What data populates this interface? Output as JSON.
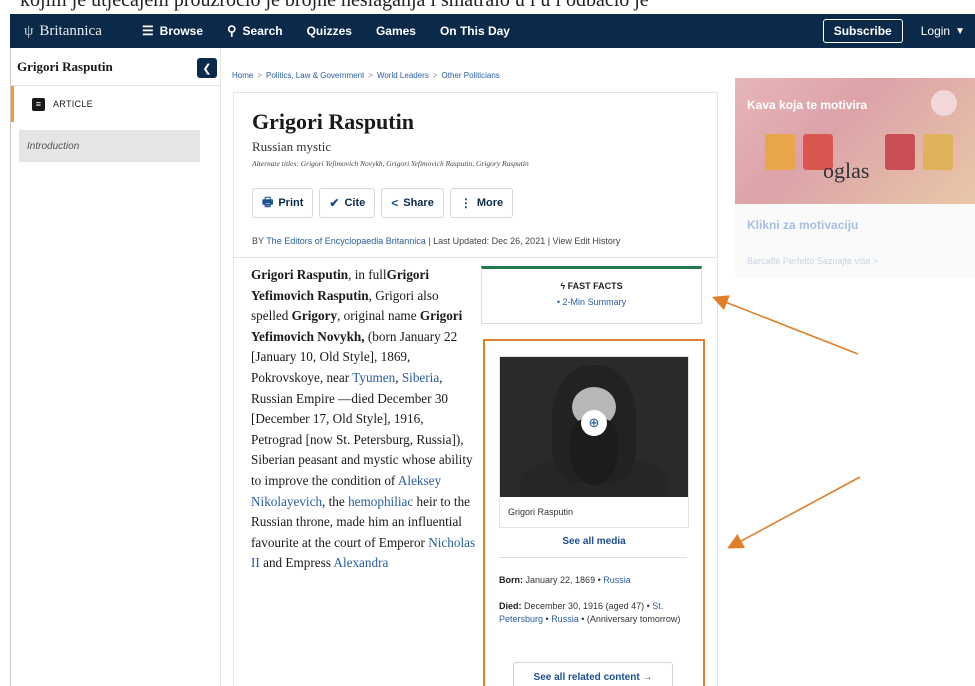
{
  "caption_text": "kojim je utjecajem prouzročio je brojne neslaganja i smatralo u i u i odbacio je",
  "topbar": {
    "logo_text": "Britannica",
    "nav": [
      {
        "label": "Browse",
        "icon": "menu-icon"
      },
      {
        "label": "Search",
        "icon": "search-icon"
      },
      {
        "label": "Quizzes"
      },
      {
        "label": "Games"
      },
      {
        "label": "On This Day"
      }
    ],
    "subscribe_label": "Subscribe",
    "login_label": "Login"
  },
  "sidebar": {
    "title": "Grigori Rasputin",
    "article_label": "ARTICLE",
    "items": [
      {
        "label": "Introduction"
      }
    ]
  },
  "breadcrumb": [
    "Home",
    "Politics, Law & Government",
    "World Leaders",
    "Other Politicians"
  ],
  "article": {
    "title": "Grigori Rasputin",
    "subtitle": "Russian mystic",
    "alt_titles": "Alternate titles: Grigori Yefimovich Novykh, Grigori Yefimovich Rasputin, Grigory Rasputin",
    "actions": [
      {
        "label": "Print",
        "icon": "printer-icon"
      },
      {
        "label": "Cite",
        "icon": "check-badge-icon"
      },
      {
        "label": "Share",
        "icon": "share-icon"
      },
      {
        "label": "More",
        "icon": "more-vertical-icon"
      }
    ],
    "byline": {
      "by": "BY",
      "authors": "The Editors of Encyclopaedia Britannica",
      "sep1": " | ",
      "updated": "Last Updated: Dec 26, 2021",
      "sep2": " | ",
      "history": "View Edit History"
    },
    "body": {
      "name": "Grigori Rasputin",
      "t1": ", in full",
      "full_name": "Grigori Yefimovich Rasputin",
      "t2": ", Grigori also spelled ",
      "alt_spelling": "Grigory",
      "t3": ", original name ",
      "orig_name": "Grigori Yefimovich Novykh,",
      "t4": " (born January 22 [January 10, Old Style], 1869, Pokrovskoye, near ",
      "link_tyumen": "Tyumen",
      "t5": ", ",
      "link_siberia": "Siberia",
      "t6": ", Russian Empire —died December 30 [December 17, Old Style], 1916, Petrograd [now St. Petersburg, Russia]), Siberian peasant and mystic whose ability to improve the condition of ",
      "link_aleksey": "Aleksey Nikolayevich",
      "t7": ", the ",
      "link_hemophiliac": "hemophiliac",
      "t8": " heir to the Russian throne, made him an influential favourite at the court of Emperor ",
      "link_nicholas": "Nicholas II",
      "t9": " and Empress ",
      "link_alexandra": "Alexandra"
    }
  },
  "fast_facts": {
    "title": "FAST FACTS",
    "icon": "bolt-icon",
    "link": "• 2-Min Summary"
  },
  "media": {
    "photo_caption": "Grigori Rasputin",
    "see_all_media": "See all media",
    "born_label": "Born:",
    "born_date": "January 22, 1869",
    "born_sep": " • ",
    "born_place": "Russia",
    "died_label": "Died:",
    "died_date": "December 30, 1916 (aged 47)",
    "died_sep1": " • ",
    "died_place1": "St. Petersburg",
    "died_sep2": " • ",
    "died_place2": "Russia",
    "died_note": " • (Anniversary tomorrow)",
    "related_label": "See all related content →"
  },
  "ad": {
    "headline": "Kava koja te motivira",
    "label": "oglas",
    "cta": "Klikni za motivaciju",
    "sub": "Barcaffè Perfetto  Saznajte više  >"
  },
  "colors": {
    "topbar": "#0b2a4a",
    "link": "#2a5d9f",
    "annotation": "#e07f2a",
    "fast_facts_accent": "#1e7a4c"
  }
}
